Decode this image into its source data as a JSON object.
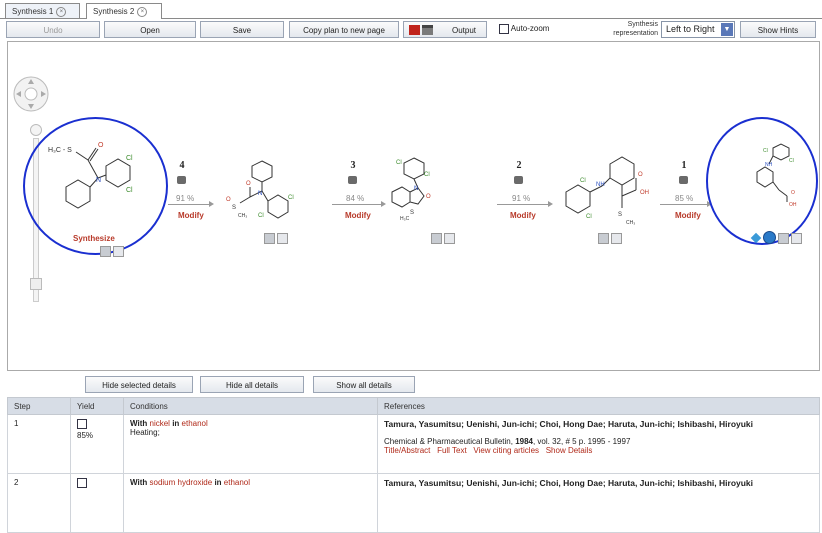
{
  "tabs": [
    {
      "label": "Synthesis 1"
    },
    {
      "label": "Synthesis 2"
    }
  ],
  "toolbar": {
    "undo": "Undo",
    "open": "Open",
    "save": "Save",
    "copy_plan": "Copy plan to new page",
    "output": "Output",
    "auto_zoom": "Auto-zoom",
    "synthesis_rep_label_1": "Synthesis",
    "synthesis_rep_label_2": "representation",
    "synthesis_rep_value": "Left to Right",
    "show_hints": "Show Hints"
  },
  "scheme": {
    "synthesize_label": "Synthesize",
    "steps": [
      {
        "num": "4",
        "yield": "91 %",
        "modify": "Modify"
      },
      {
        "num": "3",
        "yield": "84 %",
        "modify": "Modify"
      },
      {
        "num": "2",
        "yield": "91 %",
        "modify": "Modify"
      },
      {
        "num": "1",
        "yield": "85 %",
        "modify": "Modify"
      }
    ]
  },
  "details": {
    "hide_selected": "Hide selected details",
    "hide_all": "Hide all details",
    "show_all": "Show all details"
  },
  "table": {
    "headers": [
      "Step",
      "Yield",
      "Conditions",
      "References"
    ],
    "rows": [
      {
        "step": "1",
        "yield": "85%",
        "with": "With",
        "reagent": "nickel",
        "in": "in",
        "solvent": "ethanol",
        "extra": "Heating;",
        "authors": "Tamura, Yasumitsu; Uenishi, Jun-ichi; Choi, Hong Dae; Haruta, Jun-ichi; Ishibashi, Hiroyuki",
        "journal": "Chemical & Pharmaceutical Bulletin,",
        "year": "1984",
        "volume": ", vol. 32,  # 5  p. 1995 - 1997",
        "links": [
          "Title/Abstract",
          "Full Text",
          "View citing articles",
          "Show Details"
        ]
      },
      {
        "step": "2",
        "yield": "",
        "with": "With",
        "reagent": "sodium hydroxide",
        "in": "in",
        "solvent": "ethanol",
        "extra": "",
        "authors": "Tamura, Yasumitsu; Uenishi, Jun-ichi; Choi, Hong Dae; Haruta, Jun-ichi; Ishibashi, Hiroyuki"
      }
    ]
  }
}
